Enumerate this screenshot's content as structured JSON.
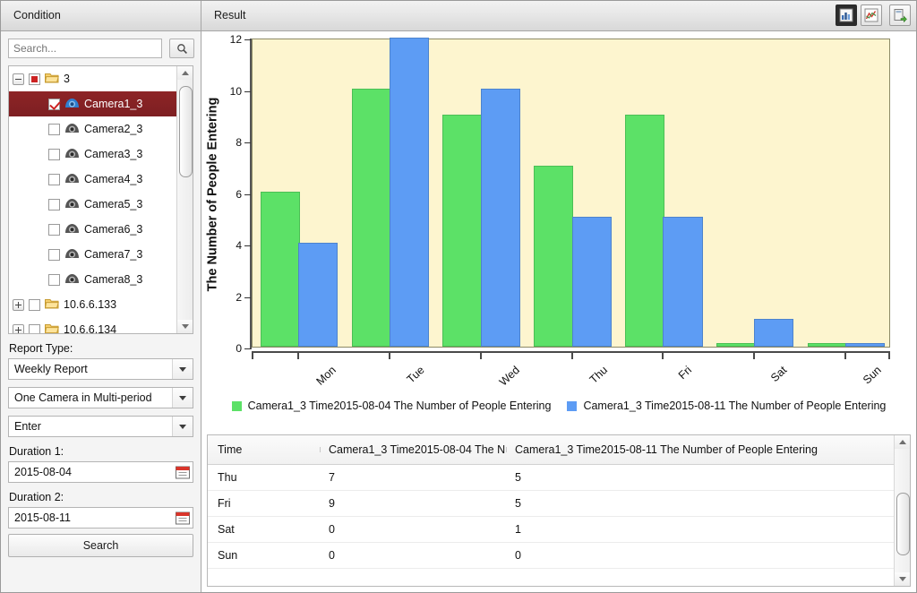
{
  "panels": {
    "condition_title": "Condition",
    "result_title": "Result"
  },
  "toolbar": {
    "bar_chart_icon": "bar-chart-icon",
    "line_chart_icon": "line-chart-icon",
    "export_icon": "export-icon"
  },
  "search": {
    "placeholder": "Search...",
    "icon": "magnifier-icon"
  },
  "tree": {
    "nodes": [
      {
        "label": "3",
        "type": "folder",
        "expander": "minus",
        "checkbox": "partial",
        "depth": 0,
        "selected": false
      },
      {
        "label": "Camera1_3",
        "type": "camera",
        "expander": "none",
        "checkbox": "checked",
        "depth": 1,
        "selected": true
      },
      {
        "label": "Camera2_3",
        "type": "camera",
        "expander": "none",
        "checkbox": "empty",
        "depth": 1,
        "selected": false
      },
      {
        "label": "Camera3_3",
        "type": "camera",
        "expander": "none",
        "checkbox": "empty",
        "depth": 1,
        "selected": false
      },
      {
        "label": "Camera4_3",
        "type": "camera",
        "expander": "none",
        "checkbox": "empty",
        "depth": 1,
        "selected": false
      },
      {
        "label": "Camera5_3",
        "type": "camera",
        "expander": "none",
        "checkbox": "empty",
        "depth": 1,
        "selected": false
      },
      {
        "label": "Camera6_3",
        "type": "camera",
        "expander": "none",
        "checkbox": "empty",
        "depth": 1,
        "selected": false
      },
      {
        "label": "Camera7_3",
        "type": "camera",
        "expander": "none",
        "checkbox": "empty",
        "depth": 1,
        "selected": false
      },
      {
        "label": "Camera8_3",
        "type": "camera",
        "expander": "none",
        "checkbox": "empty",
        "depth": 1,
        "selected": false
      },
      {
        "label": "10.6.6.133",
        "type": "folder",
        "expander": "plus",
        "checkbox": "empty",
        "depth": 0,
        "selected": false
      },
      {
        "label": "10.6.6.134",
        "type": "folder",
        "expander": "plus",
        "checkbox": "empty",
        "depth": 0,
        "selected": false
      }
    ]
  },
  "form": {
    "report_type_label": "Report Type:",
    "report_type_value": "Weekly Report",
    "mode_value": "One Camera in Multi-period",
    "flow_value": "Enter",
    "duration1_label": "Duration 1:",
    "duration1_value": "2015-08-04",
    "duration2_label": "Duration 2:",
    "duration2_value": "2015-08-11",
    "search_button": "Search"
  },
  "chart_data": {
    "type": "bar",
    "title": "",
    "xlabel": "",
    "ylabel": "The Number of People Entering",
    "ylim": [
      0,
      12
    ],
    "yticks": [
      0,
      2,
      4,
      6,
      8,
      10,
      12
    ],
    "grid": false,
    "legend_position": "bottom",
    "categories": [
      "Mon",
      "Tue",
      "Wed",
      "Thu",
      "Fri",
      "Sat",
      "Sun"
    ],
    "series": [
      {
        "name": "Camera1_3 Time2015-08-04 The Number of People Entering",
        "color": "#5ce167",
        "values": [
          6,
          10,
          9,
          7,
          9,
          0,
          0
        ]
      },
      {
        "name": "Camera1_3 Time2015-08-11 The Number of People Entering",
        "color": "#5d9cf4",
        "values": [
          4,
          12,
          10,
          5,
          5,
          1,
          0
        ]
      }
    ]
  },
  "table": {
    "columns": [
      "Time",
      "Camera1_3 Time2015-08-04 The N...",
      "Camera1_3 Time2015-08-11 The Number of People Entering"
    ],
    "rows": [
      [
        "Thu",
        "7",
        "5"
      ],
      [
        "Fri",
        "9",
        "5"
      ],
      [
        "Sat",
        "0",
        "1"
      ],
      [
        "Sun",
        "0",
        "0"
      ]
    ]
  }
}
